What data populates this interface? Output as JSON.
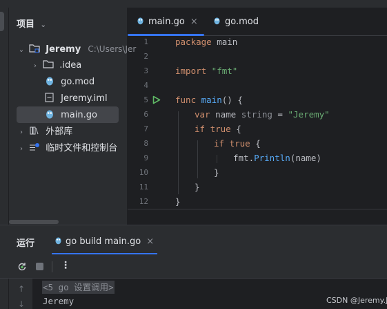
{
  "project": {
    "header": "项目",
    "tree": [
      {
        "label": "Jeremy",
        "path": "C:\\Users\\Jer",
        "level": 0,
        "expanded": true,
        "icon": "folder-module-icon"
      },
      {
        "label": ".idea",
        "level": 1,
        "expanded": false,
        "icon": "folder-icon"
      },
      {
        "label": "go.mod",
        "level": 1,
        "icon": "go-gopher-icon"
      },
      {
        "label": "Jeremy.iml",
        "level": 1,
        "icon": "iml-file-icon"
      },
      {
        "label": "main.go",
        "level": 1,
        "icon": "go-gopher-icon",
        "selected": true
      },
      {
        "label": "外部库",
        "level": 0,
        "expanded": false,
        "icon": "library-icon"
      },
      {
        "label": "临时文件和控制台",
        "level": 0,
        "expanded": false,
        "icon": "scratch-icon"
      }
    ]
  },
  "editor": {
    "tabs": [
      {
        "label": "main.go",
        "active": true,
        "close": "×"
      },
      {
        "label": "go.mod",
        "active": false
      }
    ],
    "line_numbers": [
      "1",
      "2",
      "3",
      "4",
      "5",
      "6",
      "7",
      "8",
      "9",
      "10",
      "11",
      "12"
    ],
    "code": {
      "l1_kw": "package",
      "l1_rest": " main",
      "l3_kw": "import",
      "l3_str": " \"fmt\"",
      "l5_kw": "func",
      "l5_fn": " main",
      "l5_rest": "() {",
      "l6_kw": "var",
      "l6_name": " name ",
      "l6_type": "string",
      "l6_eq": " = ",
      "l6_str": "\"Jeremy\"",
      "l7_kw": "if",
      "l7_true": " true",
      "l7_rest": " {",
      "l8_kw": "if",
      "l8_true": " true",
      "l8_rest": " {",
      "l9_pkg": "fmt.",
      "l9_fn": "Println",
      "l9_rest": "(name)",
      "l10": "}",
      "l11": "}",
      "l12": "}"
    }
  },
  "run": {
    "title": "运行",
    "tab_label": "go build main.go",
    "tab_close": "×",
    "console_lines": [
      "<5 go 设置调用>",
      "Jeremy"
    ]
  },
  "watermark": "CSDN @Jeremy.Ji",
  "colors": {
    "accent": "#3574f0",
    "run_green": "#5fb865",
    "keyword": "#cf8e6d",
    "string": "#6aab73",
    "function": "#57aaf7"
  }
}
